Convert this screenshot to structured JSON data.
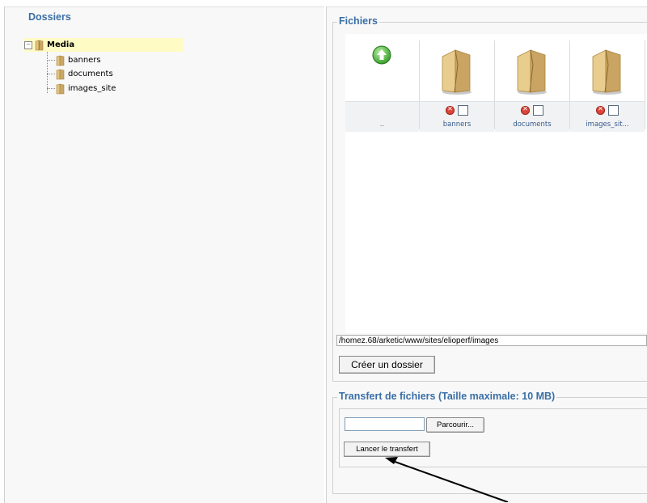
{
  "folders_panel": {
    "title": "Dossiers",
    "root": {
      "label": "Media"
    },
    "children": [
      {
        "label": "banners"
      },
      {
        "label": "documents"
      },
      {
        "label": "images_site"
      }
    ]
  },
  "files_panel": {
    "title": "Fichiers",
    "up_label": "..",
    "items": [
      {
        "name": "banners"
      },
      {
        "name": "documents"
      },
      {
        "name": "images_sit..."
      }
    ],
    "path": "/homez.68/arketic/www/sites/elioperf/images",
    "create_folder_label": "Créer un dossier"
  },
  "upload_panel": {
    "title": "Transfert de fichiers (Taille maximale: 10 MB)",
    "file_value": "",
    "browse_label": "Parcourir...",
    "submit_label": "Lancer le transfert"
  },
  "colors": {
    "heading": "#3b6fa6",
    "tree_highlight": "#fffbc4",
    "folder": "#c9a764"
  }
}
